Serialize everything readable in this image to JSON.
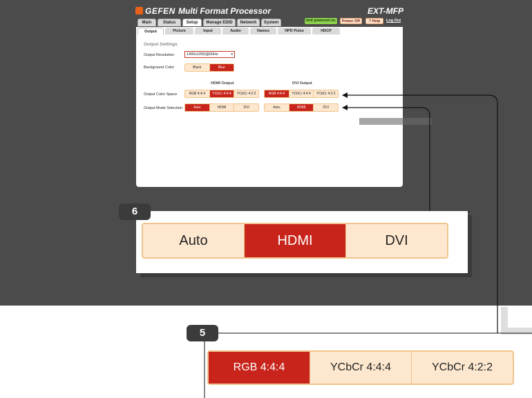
{
  "header": {
    "logo": "GEFEN",
    "title": "Multi Format Processor",
    "model": "EXT-MFP"
  },
  "nav": {
    "tabs": [
      "Main",
      "Status",
      "Setup",
      "Manage EDID",
      "Network",
      "System"
    ],
    "active": "Setup"
  },
  "status": {
    "unit_powered": "Unit powered on.",
    "power_off": "Power Off",
    "help": "? Help",
    "logout": "Log Out"
  },
  "subtabs": {
    "items": [
      "Output",
      "Picture",
      "Input",
      "Audio",
      "Names",
      "HPD Pulse",
      "HDCP"
    ],
    "active": "Output"
  },
  "settings": {
    "section_title": "Output Settings",
    "resolution_label": "Output Resolution",
    "resolution_value": "1400x1050@60Hz",
    "background_label": "Background Color",
    "background_options": [
      "Black",
      "Blue"
    ],
    "background_selected": "Blue",
    "hdmi_header": "HDMI Output",
    "dvi_header": "DVI Output",
    "color_space_label": "Output Color Space",
    "mode_label": "Output Mode Selection",
    "hdmi_color_space": [
      "RGB 4:4:4",
      "YCbCr 4:4:4",
      "YCbCr 4:2:2"
    ],
    "hdmi_color_space_selected": "YCbCr 4:4:4",
    "dvi_color_space": [
      "RGB 4:4:4",
      "YCbCr 4:4:4",
      "YCbCr 4:2:2"
    ],
    "dvi_color_space_selected": "RGB 4:4:4",
    "hdmi_mode": [
      "Auto",
      "HDMI",
      "DVI"
    ],
    "hdmi_mode_selected": "Auto",
    "dvi_mode": [
      "Auto",
      "HDMI",
      "DVI"
    ],
    "dvi_mode_selected": "HDMI"
  },
  "callouts": {
    "six": {
      "badge": "6",
      "options": [
        "Auto",
        "HDMI",
        "DVI"
      ],
      "selected": "HDMI"
    },
    "five": {
      "badge": "5",
      "options": [
        "RGB 4:4:4",
        "YCbCr 4:4:4",
        "YCbCr 4:2:2"
      ],
      "selected": "RGB 4:4:4"
    }
  },
  "colors": {
    "backdrop": "#4b4b4b",
    "accent_red": "#c8241b",
    "option_bg": "#fde8cf",
    "powered_green": "#8cd14d"
  }
}
